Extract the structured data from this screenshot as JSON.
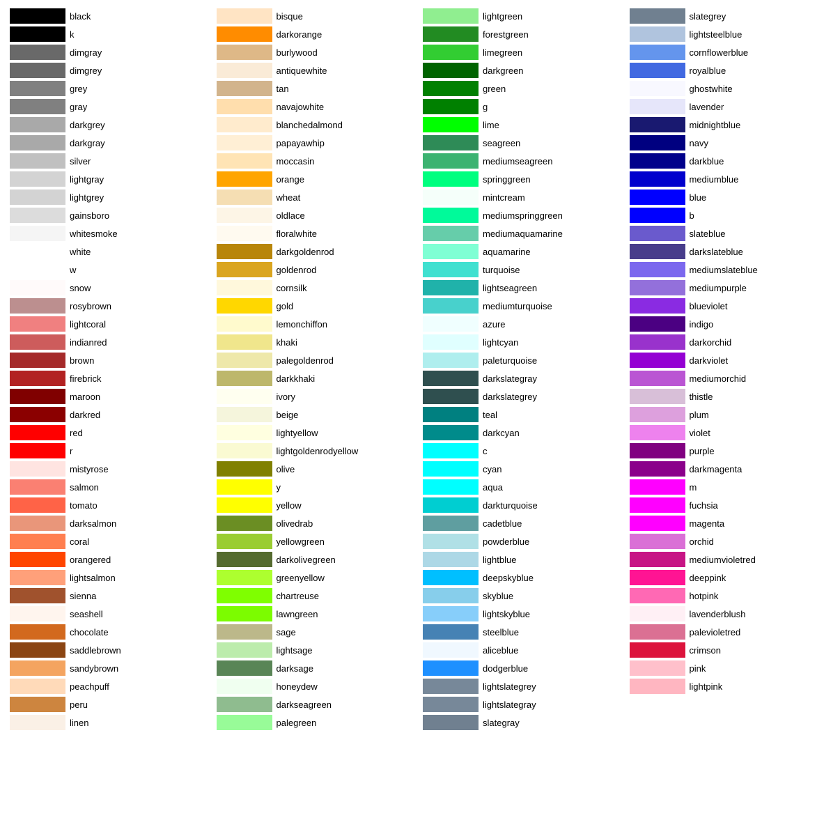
{
  "columns": [
    {
      "items": [
        {
          "name": "black",
          "color": "#000000"
        },
        {
          "name": "k",
          "color": "#000000"
        },
        {
          "name": "dimgray",
          "color": "#696969"
        },
        {
          "name": "dimgrey",
          "color": "#696969"
        },
        {
          "name": "grey",
          "color": "#808080"
        },
        {
          "name": "gray",
          "color": "#808080"
        },
        {
          "name": "darkgrey",
          "color": "#a9a9a9"
        },
        {
          "name": "darkgray",
          "color": "#a9a9a9"
        },
        {
          "name": "silver",
          "color": "#c0c0c0"
        },
        {
          "name": "lightgray",
          "color": "#d3d3d3"
        },
        {
          "name": "lightgrey",
          "color": "#d3d3d3"
        },
        {
          "name": "gainsboro",
          "color": "#dcdcdc"
        },
        {
          "name": "whitesmoke",
          "color": "#f5f5f5"
        },
        {
          "name": "white",
          "color": "#ffffff"
        },
        {
          "name": "w",
          "color": "#ffffff"
        },
        {
          "name": "snow",
          "color": "#fffafa"
        },
        {
          "name": "rosybrown",
          "color": "#bc8f8f"
        },
        {
          "name": "lightcoral",
          "color": "#f08080"
        },
        {
          "name": "indianred",
          "color": "#cd5c5c"
        },
        {
          "name": "brown",
          "color": "#a52a2a"
        },
        {
          "name": "firebrick",
          "color": "#b22222"
        },
        {
          "name": "maroon",
          "color": "#800000"
        },
        {
          "name": "darkred",
          "color": "#8b0000"
        },
        {
          "name": "red",
          "color": "#ff0000"
        },
        {
          "name": "r",
          "color": "#ff0000"
        },
        {
          "name": "mistyrose",
          "color": "#ffe4e1"
        },
        {
          "name": "salmon",
          "color": "#fa8072"
        },
        {
          "name": "tomato",
          "color": "#ff6347"
        },
        {
          "name": "darksalmon",
          "color": "#e9967a"
        },
        {
          "name": "coral",
          "color": "#ff7f50"
        },
        {
          "name": "orangered",
          "color": "#ff4500"
        },
        {
          "name": "lightsalmon",
          "color": "#ffa07a"
        },
        {
          "name": "sienna",
          "color": "#a0522d"
        },
        {
          "name": "seashell",
          "color": "#fff5ee"
        },
        {
          "name": "chocolate",
          "color": "#d2691e"
        },
        {
          "name": "saddlebrown",
          "color": "#8b4513"
        },
        {
          "name": "sandybrown",
          "color": "#f4a460"
        },
        {
          "name": "peachpuff",
          "color": "#ffdab9"
        },
        {
          "name": "peru",
          "color": "#cd853f"
        },
        {
          "name": "linen",
          "color": "#faf0e6"
        }
      ]
    },
    {
      "items": [
        {
          "name": "bisque",
          "color": "#ffe4c4"
        },
        {
          "name": "darkorange",
          "color": "#ff8c00"
        },
        {
          "name": "burlywood",
          "color": "#deb887"
        },
        {
          "name": "antiquewhite",
          "color": "#faebd7"
        },
        {
          "name": "tan",
          "color": "#d2b48c"
        },
        {
          "name": "navajowhite",
          "color": "#ffdead"
        },
        {
          "name": "blanchedalmond",
          "color": "#ffebcd"
        },
        {
          "name": "papayawhip",
          "color": "#ffefd5"
        },
        {
          "name": "moccasin",
          "color": "#ffe4b5"
        },
        {
          "name": "orange",
          "color": "#ffa500"
        },
        {
          "name": "wheat",
          "color": "#f5deb3"
        },
        {
          "name": "oldlace",
          "color": "#fdf5e6"
        },
        {
          "name": "floralwhite",
          "color": "#fffaf0"
        },
        {
          "name": "darkgoldenrod",
          "color": "#b8860b"
        },
        {
          "name": "goldenrod",
          "color": "#daa520"
        },
        {
          "name": "cornsilk",
          "color": "#fff8dc"
        },
        {
          "name": "gold",
          "color": "#ffd700"
        },
        {
          "name": "lemonchiffon",
          "color": "#fffacd"
        },
        {
          "name": "khaki",
          "color": "#f0e68c"
        },
        {
          "name": "palegoldenrod",
          "color": "#eee8aa"
        },
        {
          "name": "darkkhaki",
          "color": "#bdb76b"
        },
        {
          "name": "ivory",
          "color": "#fffff0"
        },
        {
          "name": "beige",
          "color": "#f5f5dc"
        },
        {
          "name": "lightyellow",
          "color": "#ffffe0"
        },
        {
          "name": "lightgoldenrodyellow",
          "color": "#fafad2"
        },
        {
          "name": "olive",
          "color": "#808000"
        },
        {
          "name": "y",
          "color": "#ffff00"
        },
        {
          "name": "yellow",
          "color": "#ffff00"
        },
        {
          "name": "olivedrab",
          "color": "#6b8e23"
        },
        {
          "name": "yellowgreen",
          "color": "#9acd32"
        },
        {
          "name": "darkolivegreen",
          "color": "#556b2f"
        },
        {
          "name": "greenyellow",
          "color": "#adff2f"
        },
        {
          "name": "chartreuse",
          "color": "#7fff00"
        },
        {
          "name": "lawngreen",
          "color": "#7cfc00"
        },
        {
          "name": "sage",
          "color": "#bcb88a"
        },
        {
          "name": "lightsage",
          "color": "#bcecac"
        },
        {
          "name": "darksage",
          "color": "#598556"
        },
        {
          "name": "honeydew",
          "color": "#f0fff0"
        },
        {
          "name": "darkseagreen",
          "color": "#8fbc8f"
        },
        {
          "name": "palegreen",
          "color": "#98fb98"
        }
      ]
    },
    {
      "items": [
        {
          "name": "lightgreen",
          "color": "#90ee90"
        },
        {
          "name": "forestgreen",
          "color": "#228b22"
        },
        {
          "name": "limegreen",
          "color": "#32cd32"
        },
        {
          "name": "darkgreen",
          "color": "#006400"
        },
        {
          "name": "green",
          "color": "#008000"
        },
        {
          "name": "g",
          "color": "#008000"
        },
        {
          "name": "lime",
          "color": "#00ff00"
        },
        {
          "name": "seagreen",
          "color": "#2e8b57"
        },
        {
          "name": "mediumseagreen",
          "color": "#3cb371"
        },
        {
          "name": "springgreen",
          "color": "#00ff7f"
        },
        {
          "name": "mintcream",
          "color": "#f5fffa"
        },
        {
          "name": "mediumspringgreen",
          "color": "#00fa9a"
        },
        {
          "name": "mediumaquamarine",
          "color": "#66cdaa"
        },
        {
          "name": "aquamarine",
          "color": "#7fffd4"
        },
        {
          "name": "turquoise",
          "color": "#40e0d0"
        },
        {
          "name": "lightseagreen",
          "color": "#20b2aa"
        },
        {
          "name": "mediumturquoise",
          "color": "#48d1cc"
        },
        {
          "name": "azure",
          "color": "#f0ffff"
        },
        {
          "name": "lightcyan",
          "color": "#e0ffff"
        },
        {
          "name": "paleturquoise",
          "color": "#afeeee"
        },
        {
          "name": "darkslategray",
          "color": "#2f4f4f"
        },
        {
          "name": "darkslategrey",
          "color": "#2f4f4f"
        },
        {
          "name": "teal",
          "color": "#008080"
        },
        {
          "name": "darkcyan",
          "color": "#008b8b"
        },
        {
          "name": "c",
          "color": "#00ffff"
        },
        {
          "name": "cyan",
          "color": "#00ffff"
        },
        {
          "name": "aqua",
          "color": "#00ffff"
        },
        {
          "name": "darkturquoise",
          "color": "#00ced1"
        },
        {
          "name": "cadetblue",
          "color": "#5f9ea0"
        },
        {
          "name": "powderblue",
          "color": "#b0e0e6"
        },
        {
          "name": "lightblue",
          "color": "#add8e6"
        },
        {
          "name": "deepskyblue",
          "color": "#00bfff"
        },
        {
          "name": "skyblue",
          "color": "#87ceeb"
        },
        {
          "name": "lightskyblue",
          "color": "#87cefa"
        },
        {
          "name": "steelblue",
          "color": "#4682b4"
        },
        {
          "name": "aliceblue",
          "color": "#f0f8ff"
        },
        {
          "name": "dodgerblue",
          "color": "#1e90ff"
        },
        {
          "name": "lightslategrey",
          "color": "#778899"
        },
        {
          "name": "lightslategray",
          "color": "#778899"
        },
        {
          "name": "slategray",
          "color": "#708090"
        }
      ]
    },
    {
      "items": [
        {
          "name": "slategrey",
          "color": "#708090"
        },
        {
          "name": "lightsteelblue",
          "color": "#b0c4de"
        },
        {
          "name": "cornflowerblue",
          "color": "#6495ed"
        },
        {
          "name": "royalblue",
          "color": "#4169e1"
        },
        {
          "name": "ghostwhite",
          "color": "#f8f8ff"
        },
        {
          "name": "lavender",
          "color": "#e6e6fa"
        },
        {
          "name": "midnightblue",
          "color": "#191970"
        },
        {
          "name": "navy",
          "color": "#000080"
        },
        {
          "name": "darkblue",
          "color": "#00008b"
        },
        {
          "name": "mediumblue",
          "color": "#0000cd"
        },
        {
          "name": "blue",
          "color": "#0000ff"
        },
        {
          "name": "b",
          "color": "#0000ff"
        },
        {
          "name": "slateblue",
          "color": "#6a5acd"
        },
        {
          "name": "darkslateblue",
          "color": "#483d8b"
        },
        {
          "name": "mediumslateblue",
          "color": "#7b68ee"
        },
        {
          "name": "mediumpurple",
          "color": "#9370db"
        },
        {
          "name": "blueviolet",
          "color": "#8a2be2"
        },
        {
          "name": "indigo",
          "color": "#4b0082"
        },
        {
          "name": "darkorchid",
          "color": "#9932cc"
        },
        {
          "name": "darkviolet",
          "color": "#9400d3"
        },
        {
          "name": "mediumorchid",
          "color": "#ba55d3"
        },
        {
          "name": "thistle",
          "color": "#d8bfd8"
        },
        {
          "name": "plum",
          "color": "#dda0dd"
        },
        {
          "name": "violet",
          "color": "#ee82ee"
        },
        {
          "name": "purple",
          "color": "#800080"
        },
        {
          "name": "darkmagenta",
          "color": "#8b008b"
        },
        {
          "name": "m",
          "color": "#ff00ff"
        },
        {
          "name": "fuchsia",
          "color": "#ff00ff"
        },
        {
          "name": "magenta",
          "color": "#ff00ff"
        },
        {
          "name": "orchid",
          "color": "#da70d6"
        },
        {
          "name": "mediumvioletred",
          "color": "#c71585"
        },
        {
          "name": "deeppink",
          "color": "#ff1493"
        },
        {
          "name": "hotpink",
          "color": "#ff69b4"
        },
        {
          "name": "lavenderblush",
          "color": "#fff0f5"
        },
        {
          "name": "palevioletred",
          "color": "#db7093"
        },
        {
          "name": "crimson",
          "color": "#dc143c"
        },
        {
          "name": "pink",
          "color": "#ffc0cb"
        },
        {
          "name": "lightpink",
          "color": "#ffb6c1"
        }
      ]
    }
  ]
}
